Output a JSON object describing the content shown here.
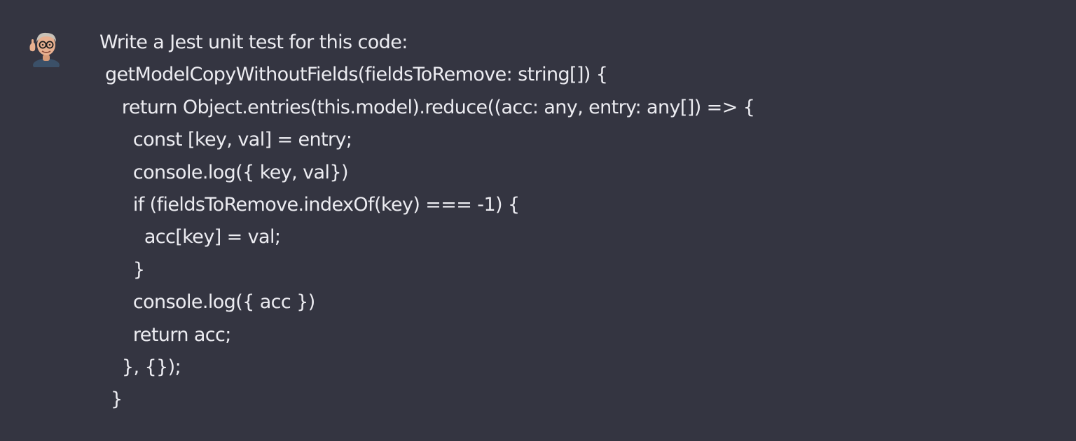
{
  "colors": {
    "background": "#343541",
    "text": "#ececf1"
  },
  "user": {
    "avatar_icon": "memoji-avatar-icon"
  },
  "message": {
    "lines": [
      "Write a Jest unit test for this code:",
      " getModelCopyWithoutFields(fieldsToRemove: string[]) {",
      "    return Object.entries(this.model).reduce((acc: any, entry: any[]) => {",
      "      const [key, val] = entry;",
      "      console.log({ key, val})",
      "      if (fieldsToRemove.indexOf(key) === -1) {",
      "        acc[key] = val;",
      "      }",
      "      console.log({ acc })",
      "      return acc;",
      "    }, {});",
      "  }"
    ]
  }
}
